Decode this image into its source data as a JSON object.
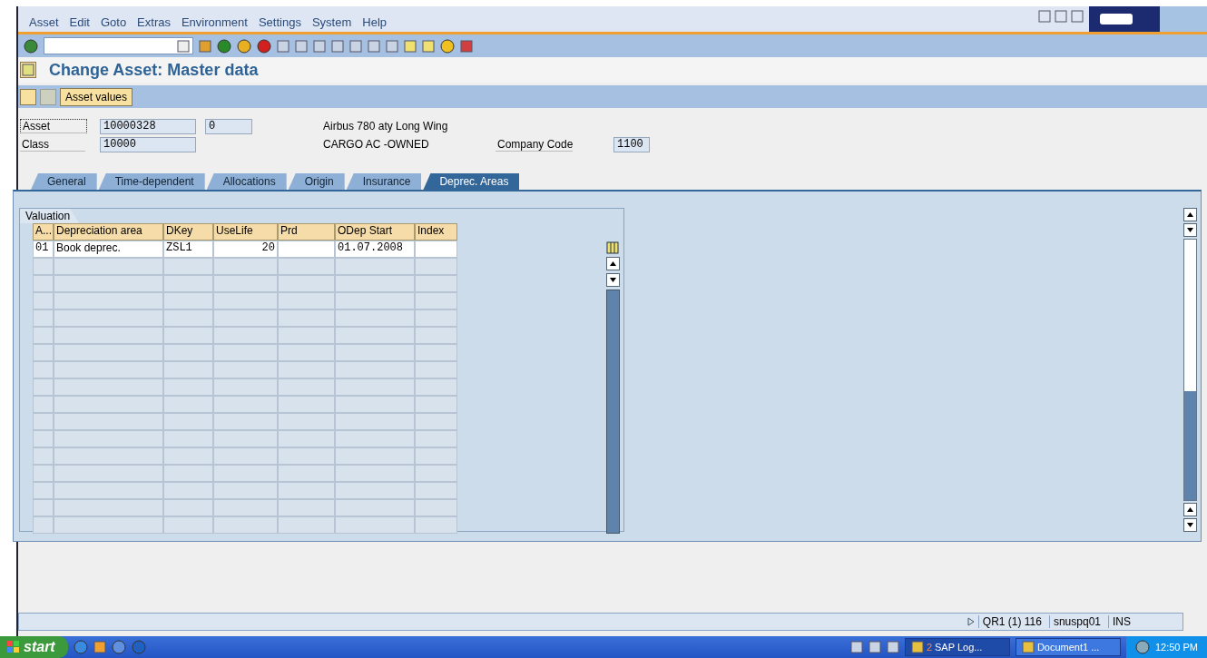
{
  "menu": [
    "Asset",
    "Edit",
    "Goto",
    "Extras",
    "Environment",
    "Settings",
    "System",
    "Help"
  ],
  "title": "Change Asset:  Master data",
  "app_toolbar": {
    "button": "Asset values"
  },
  "header": {
    "asset_label": "Asset",
    "asset": "10000328",
    "sub_number": "0",
    "description": "Airbus 780 aty Long Wing",
    "class_label": "Class",
    "class": "10000",
    "class_text": "CARGO AC -OWNED",
    "company_code_label": "Company Code",
    "company_code": "1100"
  },
  "tabs": [
    {
      "label": "General",
      "selected": false
    },
    {
      "label": "Time-dependent",
      "selected": false
    },
    {
      "label": "Allocations",
      "selected": false
    },
    {
      "label": "Origin",
      "selected": false
    },
    {
      "label": "Insurance",
      "selected": false
    },
    {
      "label": "Deprec. Areas",
      "selected": true
    }
  ],
  "group_title": "Valuation",
  "table": {
    "columns": [
      "A...",
      "Depreciation area",
      "DKey",
      "UseLife",
      "Prd",
      "ODep Start",
      "Index"
    ],
    "rows": [
      [
        "01",
        "Book deprec.",
        "ZSL1",
        "20",
        "",
        "01.07.2008",
        ""
      ]
    ]
  },
  "status_bar": {
    "system": "QR1 (1) 116",
    "server": "snuspq01",
    "mode": "INS"
  },
  "taskbar": {
    "start": "start",
    "tasks": [
      {
        "count": "2",
        "label": "SAP Log...",
        "selected": true
      },
      {
        "label": "Document1 ...",
        "selected": false
      }
    ],
    "clock": "12:50 PM"
  }
}
